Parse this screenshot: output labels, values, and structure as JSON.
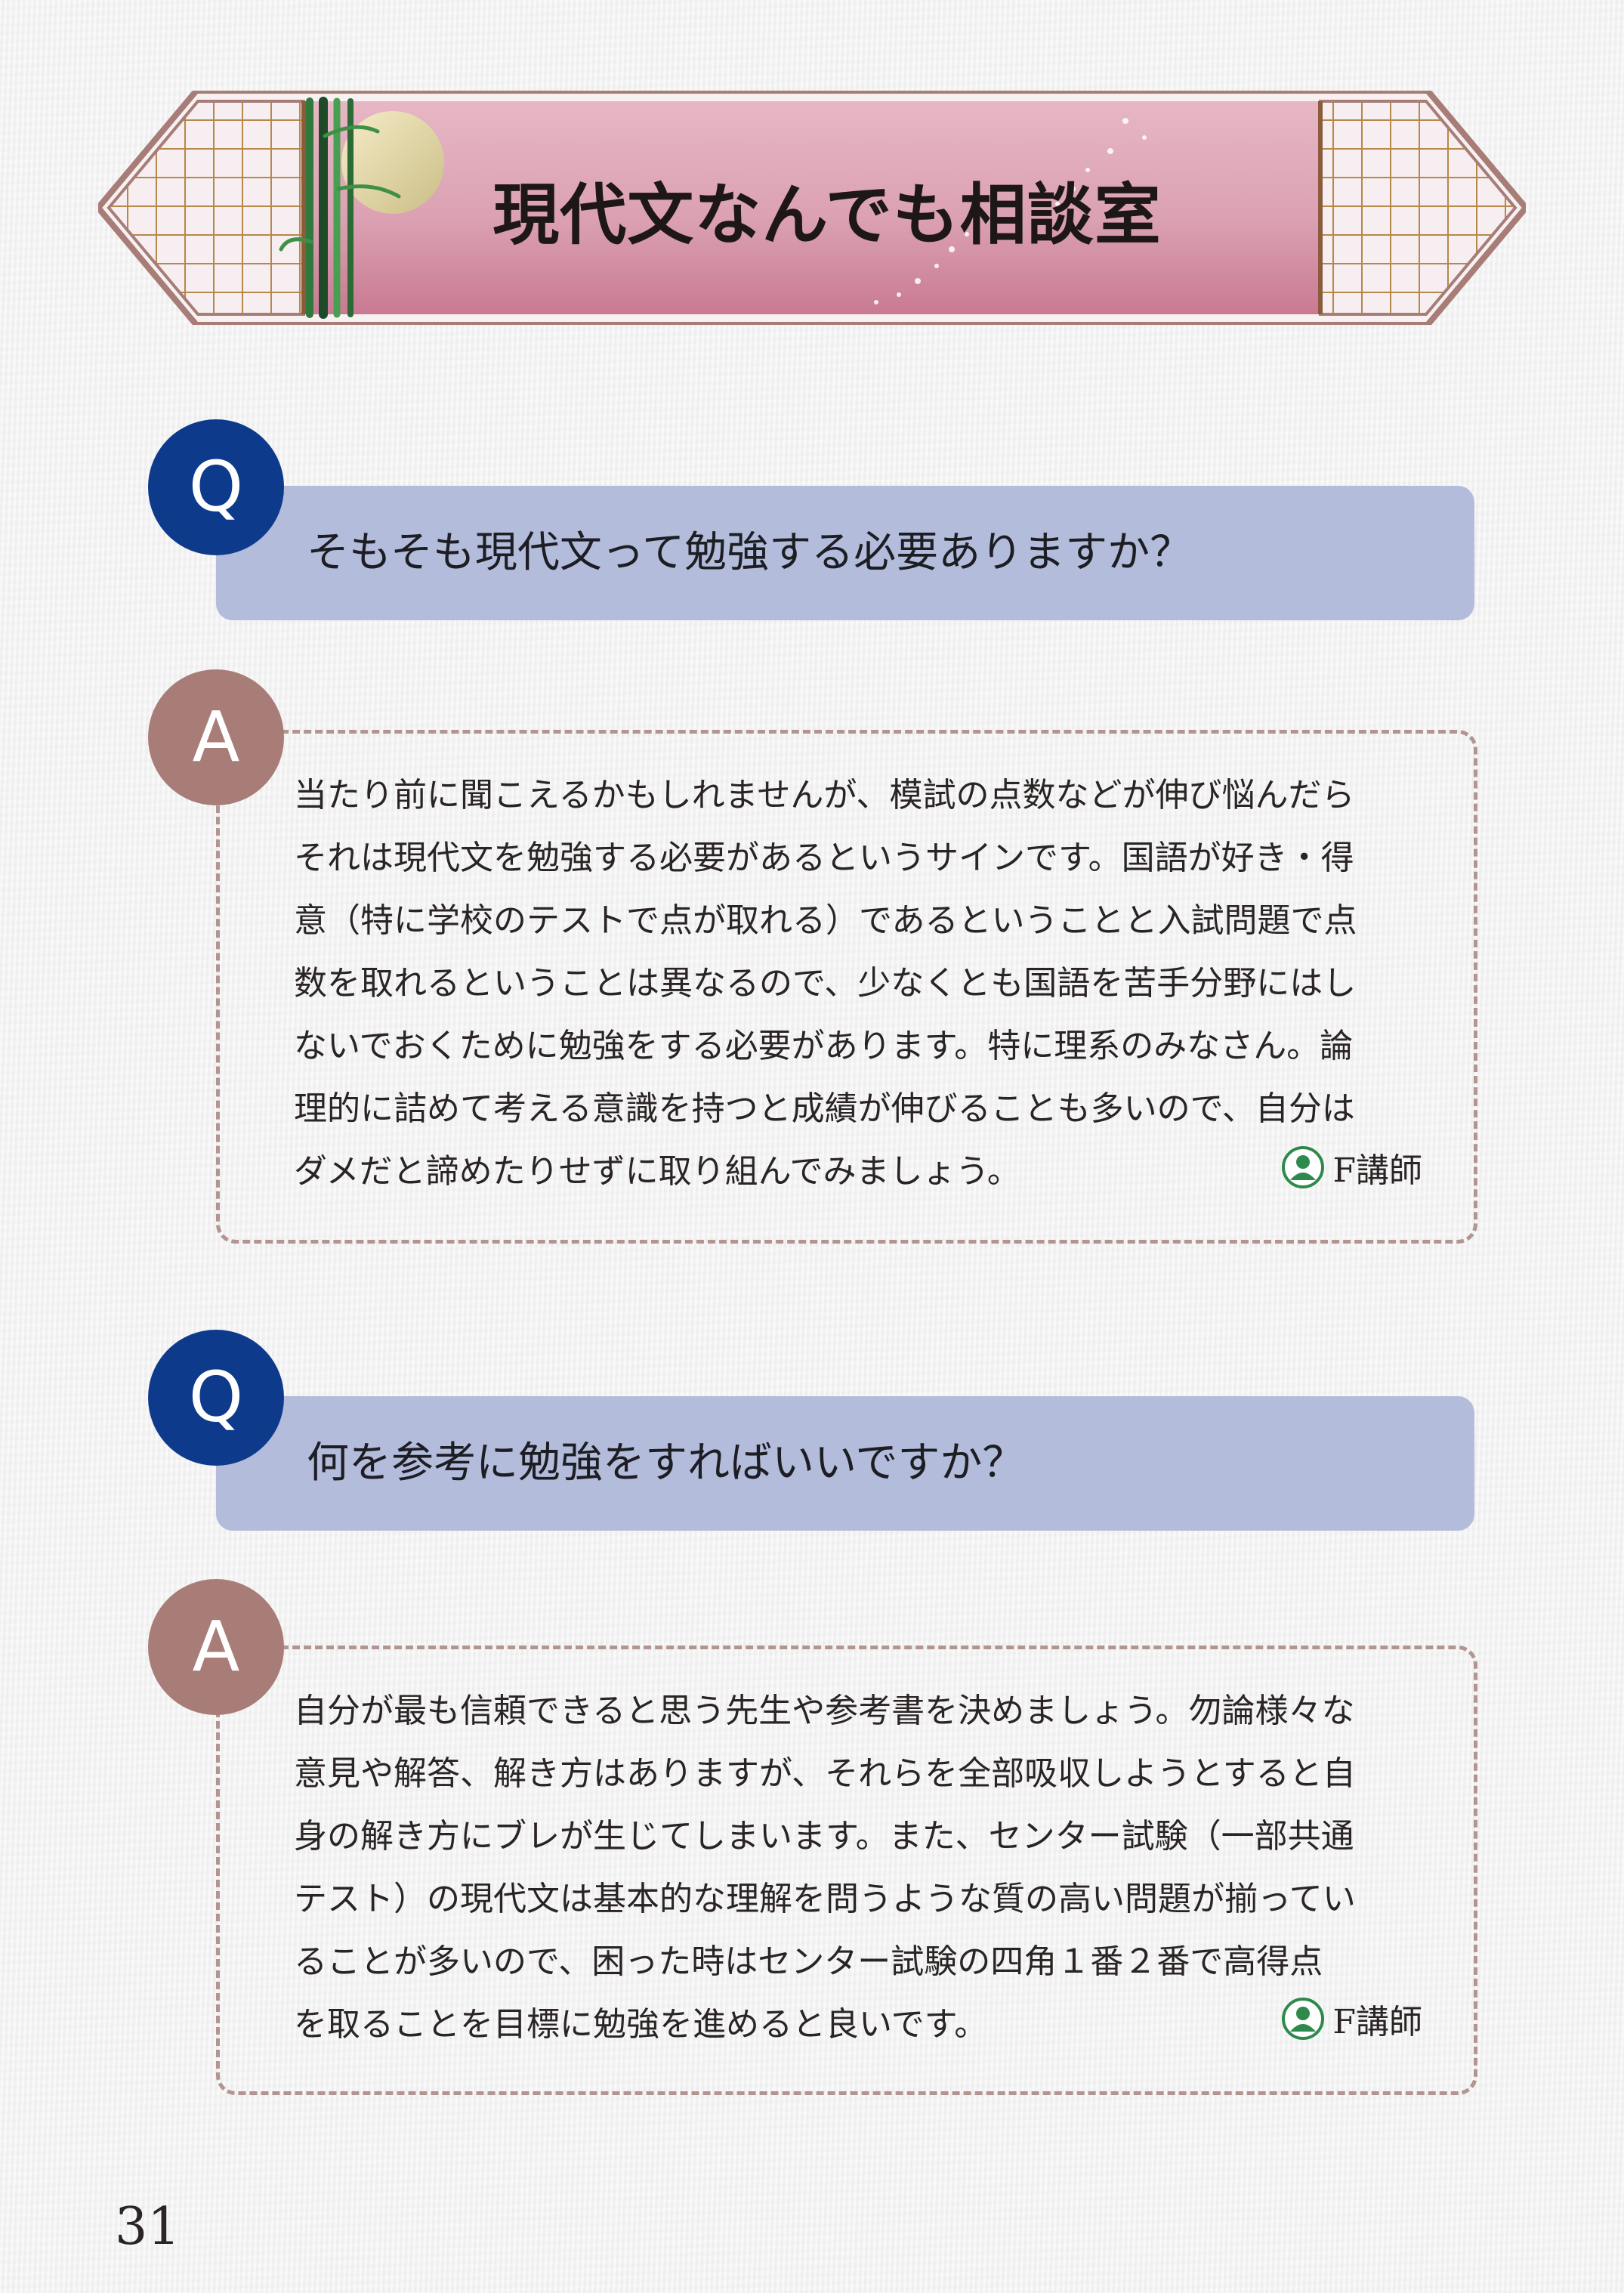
{
  "header": {
    "title": "現代文なんでも相談室"
  },
  "colors": {
    "q_badge": "#0e3a8c",
    "a_badge": "#a87c77",
    "question_bar": "#b3bcda",
    "answer_border": "#b29590",
    "banner_pink": "#d79aae",
    "teacher_icon": "#2e8a4c"
  },
  "qa": [
    {
      "q_label": "Q",
      "question": "そもそも現代文って勉強する必要ありますか？",
      "a_label": "A",
      "answer_lines": [
        "当たり前に聞こえるかもしれませんが、模試の点数などが伸び悩んだら",
        "それは現代文を勉強する必要があるというサインです。国語が好き・得",
        "意（特に学校のテストで点が取れる）であるということと入試問題で点",
        "数を取れるということは異なるので、少なくとも国語を苦手分野にはし",
        "ないでおくために勉強をする必要があります。特に理系のみなさん。論",
        "理的に詰めて考える意識を持つと成績が伸びることも多いので、自分は",
        "ダメだと諦めたりせずに取り組んでみましょう。"
      ],
      "teacher_icon": "person-icon",
      "teacher": "F講師"
    },
    {
      "q_label": "Q",
      "question": "何を参考に勉強をすればいいですか？",
      "a_label": "A",
      "answer_lines": [
        "自分が最も信頼できると思う先生や参考書を決めましょう。勿論様々な",
        "意見や解答、解き方はありますが、それらを全部吸収しようとすると自",
        "身の解き方にブレが生じてしまいます。また、センター試験（一部共通",
        "テスト）の現代文は基本的な理解を問うような質の高い問題が揃ってい",
        "ることが多いので、困った時はセンター試験の四角１番２番で高得点",
        "を取ることを目標に勉強を進めると良いです。"
      ],
      "teacher_icon": "person-icon",
      "teacher": "F講師"
    }
  ],
  "footer": {
    "page_number": "31"
  }
}
